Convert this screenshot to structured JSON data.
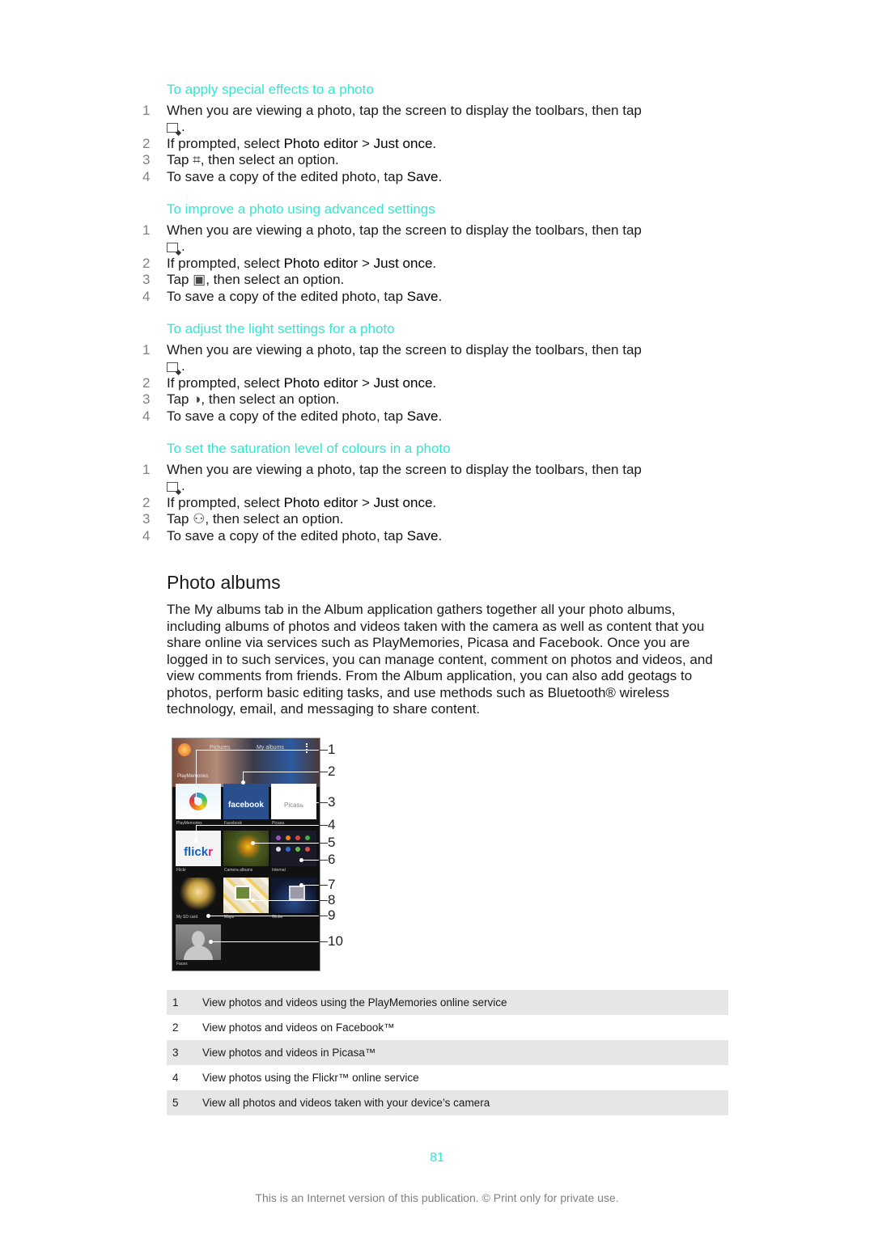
{
  "colors": {
    "heading_accent": "#2ee8d4",
    "table_shade": "#e6e6e6",
    "step_number": "#808080"
  },
  "procedures": [
    {
      "title": "To apply special effects to a photo",
      "steps": [
        {
          "num": "1",
          "text": "When you are viewing a photo, tap the screen to display the toolbars, then tap",
          "cont_icon": "photo-edit-icon",
          "cont_text": "."
        },
        {
          "num": "2",
          "pre": "If prompted, select ",
          "b1": "Photo editor",
          "mid": " > ",
          "b2": "Just once",
          "post": "."
        },
        {
          "num": "3",
          "pre": "Tap ",
          "icon": "crop-effects-icon",
          "icon_glyph": "⌗",
          "post": ", then select an option."
        },
        {
          "num": "4",
          "pre": "To save a copy of the edited photo, tap ",
          "b1": "Save",
          "post": "."
        }
      ]
    },
    {
      "title": "To improve a photo using advanced settings",
      "steps": [
        {
          "num": "1",
          "text": "When you are viewing a photo, tap the screen to display the toolbars, then tap",
          "cont_icon": "photo-edit-icon",
          "cont_text": "."
        },
        {
          "num": "2",
          "pre": "If prompted, select ",
          "b1": "Photo editor",
          "mid": " > ",
          "b2": "Just once",
          "post": "."
        },
        {
          "num": "3",
          "pre": "Tap ",
          "icon": "advanced-settings-icon",
          "icon_glyph": "▣",
          "post": ", then select an option."
        },
        {
          "num": "4",
          "pre": "To save a copy of the edited photo, tap ",
          "b1": "Save",
          "post": "."
        }
      ]
    },
    {
      "title": "To adjust the light settings for a photo",
      "steps": [
        {
          "num": "1",
          "text": "When you are viewing a photo, tap the screen to display the toolbars, then tap",
          "cont_icon": "photo-edit-icon",
          "cont_text": "."
        },
        {
          "num": "2",
          "pre": "If prompted, select ",
          "b1": "Photo editor",
          "mid": " > ",
          "b2": "Just once",
          "post": "."
        },
        {
          "num": "3",
          "pre": "Tap ",
          "icon": "light-settings-icon",
          "icon_glyph": "◑",
          "post": ", then select an option."
        },
        {
          "num": "4",
          "pre": "To save a copy of the edited photo, tap ",
          "b1": "Save",
          "post": "."
        }
      ]
    },
    {
      "title": "To set the saturation level of colours in a photo",
      "steps": [
        {
          "num": "1",
          "text": "When you are viewing a photo, tap the screen to display the toolbars, then tap",
          "cont_icon": "photo-edit-icon",
          "cont_text": "."
        },
        {
          "num": "2",
          "pre": "If prompted, select ",
          "b1": "Photo editor",
          "mid": " > ",
          "b2": "Just once",
          "post": "."
        },
        {
          "num": "3",
          "pre": "Tap ",
          "icon": "saturation-icon",
          "icon_glyph": "⚇",
          "post": ", then select an option."
        },
        {
          "num": "4",
          "pre": "To save a copy of the edited photo, tap ",
          "b1": "Save",
          "post": "."
        }
      ]
    }
  ],
  "chapter": {
    "title": "Photo albums",
    "intro": "The My albums tab in the Album application gathers together all your photo albums, including albums of photos and videos taken with the camera as well as content that you share online via services such as PlayMemories, Picasa and Facebook. Once you are logged in to such services, you can manage content, comment on photos and videos, and view comments from friends. From the Album application, you can also add geotags to photos, perform basic editing tasks, and use methods such as Bluetooth® wireless technology, email, and messaging to share content."
  },
  "figure": {
    "tabs": [
      "Pictures",
      "My albums"
    ],
    "section_label": "PlayMemories",
    "tiles": [
      {
        "label": "PlayMemories",
        "logo": ""
      },
      {
        "label": "Facebook",
        "logo": "facebook"
      },
      {
        "label": "Picasa",
        "logo": "Picasa"
      },
      {
        "label": "Flickr",
        "logo_a": "flick",
        "logo_b": "r"
      },
      {
        "label": "Camera albums"
      },
      {
        "label": "Internal"
      },
      {
        "label": "My SD card"
      },
      {
        "label": "Maps"
      },
      {
        "label": "Globe"
      },
      {
        "label": "Faces"
      }
    ],
    "callouts": [
      "1",
      "2",
      "3",
      "4",
      "5",
      "6",
      "7",
      "8",
      "9",
      "10"
    ]
  },
  "legend": [
    {
      "num": "1",
      "text": "View photos and videos using the PlayMemories online service"
    },
    {
      "num": "2",
      "text": "View photos and videos on Facebook™"
    },
    {
      "num": "3",
      "text": "View photos and videos in Picasa™"
    },
    {
      "num": "4",
      "text": "View photos using the Flickr™ online service"
    },
    {
      "num": "5",
      "text": "View all photos and videos taken with your device’s camera"
    }
  ],
  "page_number": "81",
  "footer": "This is an Internet version of this publication. © Print only for private use."
}
